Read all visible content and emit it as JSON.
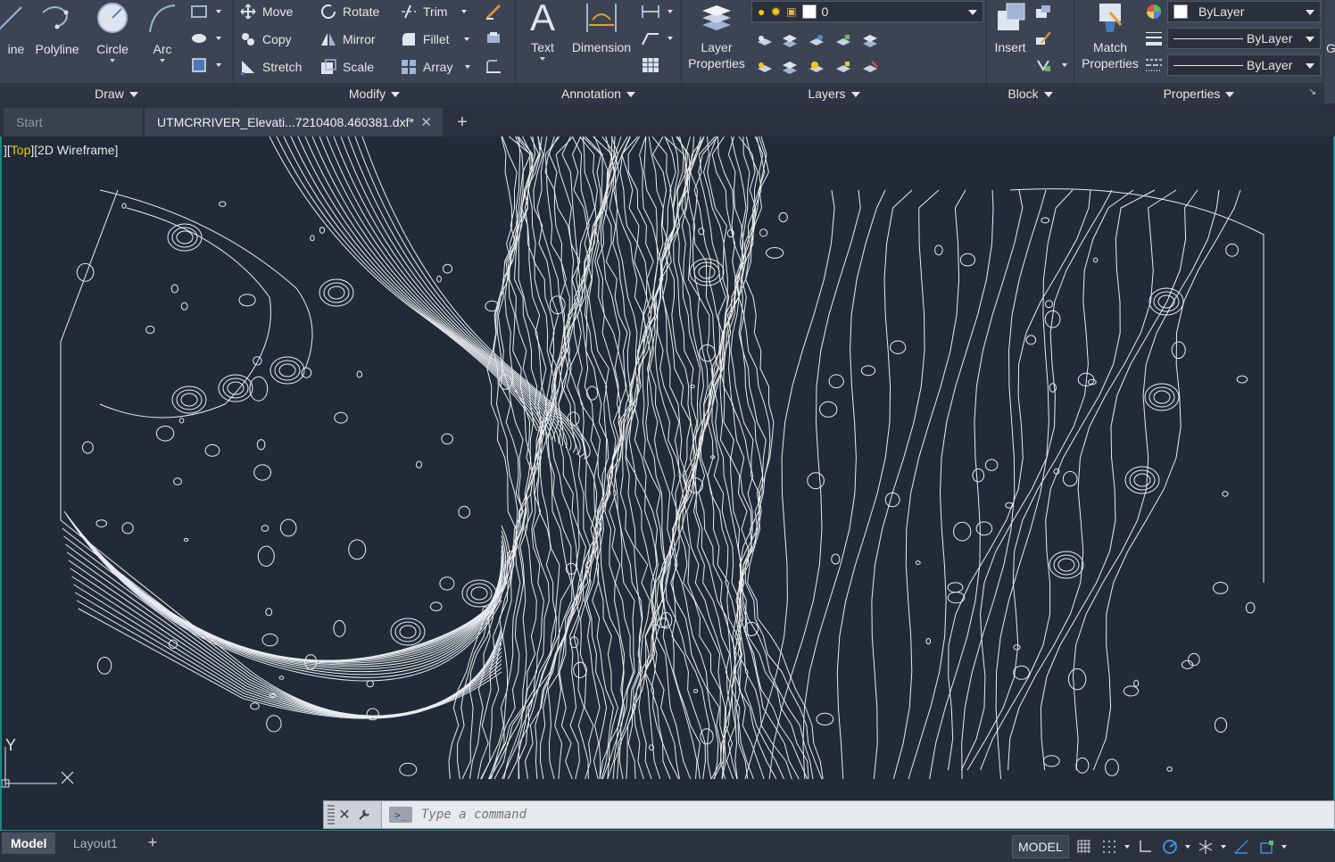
{
  "ribbon": {
    "draw": {
      "title": "Draw",
      "line_label": "ine",
      "polyline_label": "Polyline",
      "circle_label": "Circle",
      "arc_label": "Arc"
    },
    "modify": {
      "title": "Modify",
      "move_label": "Move",
      "rotate_label": "Rotate",
      "trim_label": "Trim",
      "copy_label": "Copy",
      "mirror_label": "Mirror",
      "fillet_label": "Fillet",
      "stretch_label": "Stretch",
      "scale_label": "Scale",
      "array_label": "Array"
    },
    "annotation": {
      "title": "Annotation",
      "text_label": "Text",
      "dimension_label": "Dimension"
    },
    "layers": {
      "title": "Layers",
      "layer_properties_label_1": "Layer",
      "layer_properties_label_2": "Properties",
      "current_layer": "0"
    },
    "block": {
      "title": "Block",
      "insert_label": "Insert"
    },
    "properties": {
      "title": "Properties",
      "match_label_1": "Match",
      "match_label_2": "Properties",
      "color_value": "ByLayer",
      "lineweight_value": "ByLayer",
      "linetype_value": "ByLayer"
    },
    "partial_label": "G"
  },
  "tabs": {
    "start": "Start",
    "active_file": "UTMCRRIVER_Elevati...7210408.460381.dxf*"
  },
  "viewport": {
    "prefix": "][",
    "view": "Top",
    "mid": "][",
    "style": "2D Wireframe",
    "suffix": "]"
  },
  "ucs": {
    "y_label": "Y"
  },
  "command": {
    "placeholder": "Type a command"
  },
  "status": {
    "model_tab": "Model",
    "layout1_tab": "Layout1",
    "space_button": "MODEL"
  },
  "colors": {
    "ribbon_bg": "#3c4453",
    "canvas_bg": "#212b38",
    "accent_yellow": "#f5c518",
    "border_teal": "#1a8a8a"
  }
}
